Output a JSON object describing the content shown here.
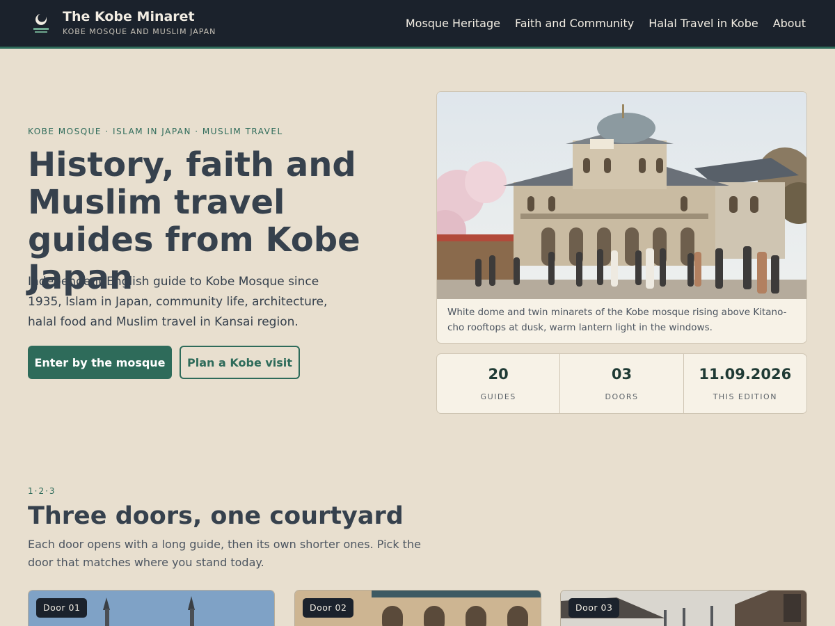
{
  "header": {
    "site_title": "The Kobe Minaret",
    "site_subtitle": "KOBE MOSQUE AND MUSLIM JAPAN",
    "logo_icon": "crescent-minaret-icon",
    "nav": [
      {
        "label": "Mosque Heritage"
      },
      {
        "label": "Faith and Community"
      },
      {
        "label": "Halal Travel in Kobe"
      },
      {
        "label": "About"
      }
    ]
  },
  "hero": {
    "eyebrow": "KOBE MOSQUE · ISLAM IN JAPAN · MUSLIM TRAVEL",
    "title": "History, faith and Muslim travel guides from Kobe Japan",
    "lead": "Independent English guide to Kobe Mosque since 1935, Islam in Japan, community life, architecture, halal food and Muslim travel in Kansai region.",
    "primary_button": "Enter by the mosque",
    "secondary_button": "Plan a Kobe visit",
    "image_caption": "White dome and twin minarets of the Kobe mosque rising above Kitano-cho rooftops at dusk, warm lantern light in the windows."
  },
  "stats": [
    {
      "value": "20",
      "label": "GUIDES"
    },
    {
      "value": "03",
      "label": "DOORS"
    },
    {
      "value": "11.09.2026",
      "label": "THIS EDITION"
    }
  ],
  "doors_section": {
    "eyebrow": "1·2·3",
    "title": "Three doors, one courtyard",
    "lead": "Each door opens with a long guide, then its own shorter ones. Pick the door that matches where you stand today.",
    "doors": [
      {
        "badge": "Door 01"
      },
      {
        "badge": "Door 02"
      },
      {
        "badge": "Door 03"
      }
    ]
  },
  "colors": {
    "page_bg": "#e8dfcf",
    "header_bg": "#1b222c",
    "accent": "#2e6b5a",
    "text": "#36414d"
  }
}
